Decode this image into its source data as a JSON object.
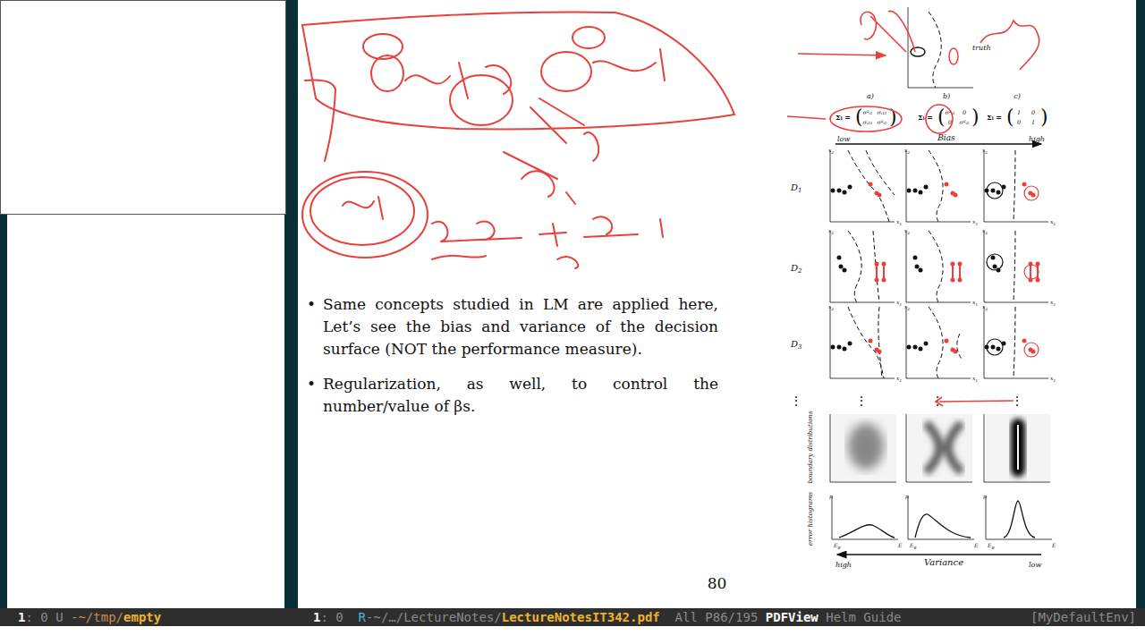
{
  "left_window": {
    "mode_line": [
      {
        "text": "1",
        "color": "#ffffff"
      },
      {
        "text": ": 0 U ",
        "color": "#8a8a8a"
      },
      {
        "text": "-~/tmp/",
        "color": "#c98a4b"
      },
      {
        "text": "empty",
        "color": "#f0b429"
      }
    ]
  },
  "pdf_window": {
    "mode_line": [
      {
        "text": "1",
        "color": "#ffffff"
      },
      {
        "text": ": 0  ",
        "color": "#8a8a8a"
      },
      {
        "text": "R",
        "color": "#4fb3d9"
      },
      {
        "text": "-~/…/LectureNotes/",
        "color": "#8a8a8a"
      },
      {
        "text": "LectureNotesIT342.pdf",
        "color": "#f0b429"
      },
      {
        "text": "  All P86/195 ",
        "color": "#8a8a8a"
      },
      {
        "text": "PDFView",
        "color": "#ffffff"
      },
      {
        "text": " Helm Guide",
        "color": "#8a8a8a"
      }
    ],
    "env": "[MyDefaultEnv]"
  },
  "page": {
    "bullet": "•",
    "bullets": [
      "Same concepts studied in LM are applied here, Let’s see the bias and variance of the decision surface (NOT the performance measure).",
      "Regularization, as well, to control the number/value of βs."
    ],
    "number": "80"
  },
  "figure": {
    "truth": "truth",
    "columns": [
      "a)",
      "b)",
      "c)"
    ],
    "matrices": [
      {
        "lhs": "Σᵢ =",
        "cells": [
          "σ²ᵢ₁",
          "σᵢ₁₂",
          "σᵢ₂₁",
          "σ²ᵢ₂"
        ]
      },
      {
        "lhs": "Σᵢ =",
        "cells": [
          "σ²ᵢ₁",
          "0",
          "0",
          "σ²ᵢ₂"
        ]
      },
      {
        "lhs": "Σᵢ =",
        "cells": [
          "1",
          "0",
          "0",
          "1"
        ]
      }
    ],
    "bias": {
      "low": "low",
      "label": "Bias",
      "high": "high"
    },
    "rows": [
      {
        "label": "D",
        "sub": "1"
      },
      {
        "label": "D",
        "sub": "2"
      },
      {
        "label": "D",
        "sub": "3"
      }
    ],
    "axis_x": {
      "text": "x",
      "sub": "1"
    },
    "axis_y": {
      "text": "x",
      "sub": "2"
    },
    "dots": "⋮",
    "boundary_label": "boundary distributions",
    "error_label": "error histograms",
    "hist_y": "p",
    "hist_x0": {
      "text": "E",
      "sub": "B"
    },
    "hist_x1": "E",
    "variance": {
      "high": "high",
      "label": "Variance",
      "low": "low"
    }
  }
}
